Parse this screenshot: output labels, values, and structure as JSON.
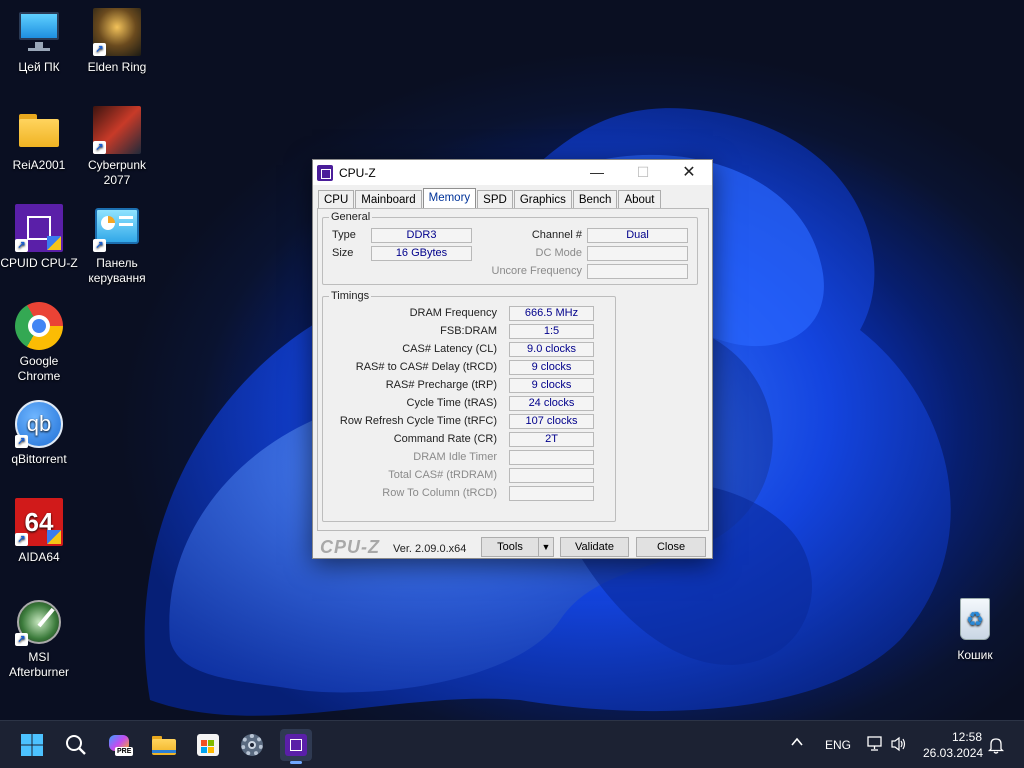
{
  "desktop": {
    "icons": [
      {
        "label": "Цей ПК"
      },
      {
        "label": "Elden Ring"
      },
      {
        "label": "ReiA2001"
      },
      {
        "label": "Cyberpunk 2077"
      },
      {
        "label": "CPUID CPU-Z"
      },
      {
        "label": "Панель керування"
      },
      {
        "label": "Google Chrome"
      },
      {
        "label": "qBittorrent"
      },
      {
        "label": "AIDA64"
      },
      {
        "label": "MSI Afterburner"
      },
      {
        "label": "Кошик"
      }
    ]
  },
  "window": {
    "title": "CPU-Z",
    "tabs": [
      "CPU",
      "Mainboard",
      "Memory",
      "SPD",
      "Graphics",
      "Bench",
      "About"
    ],
    "active_tab": "Memory",
    "general": {
      "legend": "General",
      "type_label": "Type",
      "type_value": "DDR3",
      "size_label": "Size",
      "size_value": "16 GBytes",
      "channel_label": "Channel #",
      "channel_value": "Dual",
      "dcmode_label": "DC Mode",
      "dcmode_value": "",
      "uncore_label": "Uncore Frequency",
      "uncore_value": ""
    },
    "timings": {
      "legend": "Timings",
      "rows": [
        {
          "label": "DRAM Frequency",
          "value": "666.5 MHz"
        },
        {
          "label": "FSB:DRAM",
          "value": "1:5"
        },
        {
          "label": "CAS# Latency (CL)",
          "value": "9.0 clocks"
        },
        {
          "label": "RAS# to CAS# Delay (tRCD)",
          "value": "9 clocks"
        },
        {
          "label": "RAS# Precharge (tRP)",
          "value": "9 clocks"
        },
        {
          "label": "Cycle Time (tRAS)",
          "value": "24 clocks"
        },
        {
          "label": "Row Refresh Cycle Time (tRFC)",
          "value": "107 clocks"
        },
        {
          "label": "Command Rate (CR)",
          "value": "2T"
        },
        {
          "label": "DRAM Idle Timer",
          "value": ""
        },
        {
          "label": "Total CAS# (tRDRAM)",
          "value": ""
        },
        {
          "label": "Row To Column (tRCD)",
          "value": ""
        }
      ]
    },
    "footer": {
      "logo": "CPU-Z",
      "version": "Ver. 2.09.0.x64",
      "tools_label": "Tools",
      "validate_label": "Validate",
      "close_label": "Close"
    }
  },
  "taskbar": {
    "lang": "ENG",
    "time": "12:58",
    "date": "26.03.2024",
    "copilot_badge": "PRE"
  }
}
